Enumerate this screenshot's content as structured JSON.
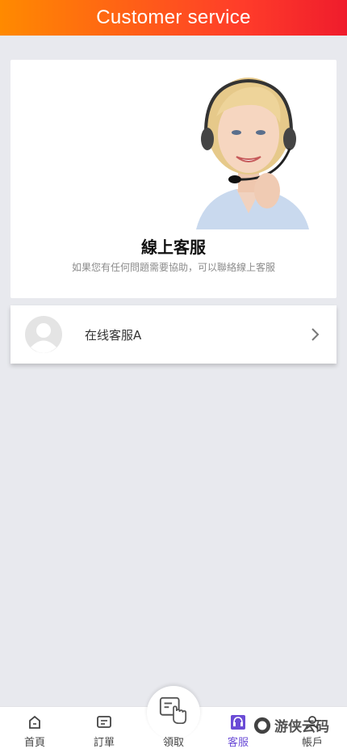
{
  "header": {
    "title": "Customer service"
  },
  "hero": {
    "title": "線上客服",
    "subtitle": "如果您有任何問題需要協助，可以聯絡線上客服",
    "photo_icon": "support-agent-photo"
  },
  "agents": [
    {
      "name": "在线客服A",
      "avatar_icon": "default-avatar-icon",
      "action_icon": "chevron-right-icon"
    }
  ],
  "tabs": [
    {
      "label": "首頁",
      "icon": "home-icon"
    },
    {
      "label": "訂單",
      "icon": "order-icon"
    },
    {
      "label": "領取",
      "icon": "hand-tap-icon"
    },
    {
      "label": "客服",
      "icon": "headset-icon",
      "active": true
    },
    {
      "label": "帳戶",
      "icon": "user-icon"
    }
  ],
  "watermark": {
    "text": "游侠云码"
  },
  "colors": {
    "header_start": "#ff8a00",
    "header_end": "#ef1c2c",
    "active_tab": "#6b4cd6",
    "background": "#e8e9ee"
  }
}
